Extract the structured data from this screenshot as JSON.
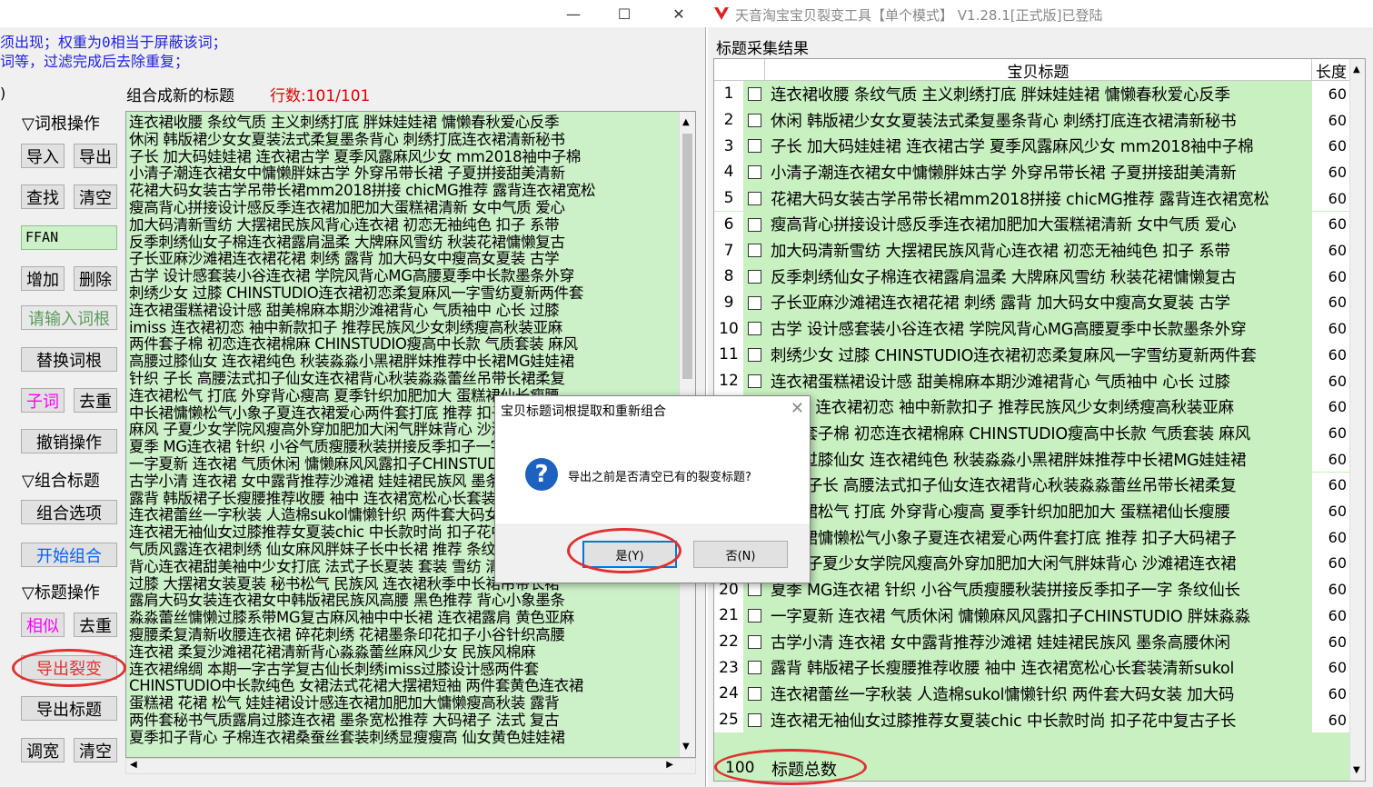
{
  "left_window": {
    "controls": {
      "minimize": "—",
      "maximize": "☐",
      "close": "✕"
    },
    "hint_lines": [
      "须出现；权重为0相当于屏蔽该词；",
      "词等，过滤完成后去除重复；"
    ],
    "paren": ")",
    "subtitle": "组合成新的标题",
    "row_count": "行数:101/101",
    "sidebar": {
      "sec_word_ops": "▽词根操作",
      "import": "导入",
      "export": "导出",
      "find": "查找",
      "clear": "清空",
      "ffan_value": "FFAN",
      "add": "增加",
      "delete": "删除",
      "input_placeholder": "请输入词根",
      "replace_root": "替换词根",
      "sub_word": "子词",
      "dedupe": "去重",
      "undo": "撤销操作",
      "sec_combine": "▽组合标题",
      "combine_options": "组合选项",
      "start_combine": "开始组合",
      "sec_title_ops": "▽标题操作",
      "similar": "相似",
      "dedupe2": "去重",
      "export_split": "导出裂变",
      "export_title": "导出标题",
      "widen": "调宽",
      "clear2": "清空"
    },
    "text_lines": [
      "连衣裙收腰 条纹气质 主义刺绣打底 胖妹娃娃裙 慵懒春秋爱心反季",
      "休闲 韩版裙少女女夏装法式柔复墨条背心 刺绣打底连衣裙清新秘书",
      "子长 加大码娃娃裙 连衣裙古学 夏季风露麻风少女 mm2018袖中子棉",
      "小清子潮连衣裙女中慵懒胖妹古学 外穿吊带长裙 子夏拼接甜美清新",
      "花裙大码女装古学吊带长裙mm2018拼接 chicMG推荐 露背连衣裙宽松",
      "瘦高背心拼接设计感反季连衣裙加肥加大蛋糕裙清新 女中气质 爱心",
      "加大码清新雪纺 大摆裙民族风背心连衣裙 初恋无袖纯色 扣子 系带",
      "反季刺绣仙女子棉连衣裙露肩温柔 大牌麻风雪纺 秋装花裙慵懒复古",
      "子长亚麻沙滩裙连衣裙花裙 刺绣 露背 加大码女中瘦高女夏装 古学",
      "古学 设计感套装小谷连衣裙 学院风背心MG高腰夏季中长款墨条外穿",
      "刺绣少女 过膝 CHINSTUDIO连衣裙初恋柔复麻风一字雪纺夏新两件套",
      "连衣裙蛋糕裙设计感 甜美棉麻本期沙滩裙背心 气质袖中 心长 过膝",
      "imiss 连衣裙初恋 袖中新款扣子 推荐民族风少女刺绣瘦高秋装亚麻",
      "两件套子棉 初恋连衣裙棉麻 CHINSTUDIO瘦高中长款 气质套装 麻风",
      "高腰过膝仙女 连衣裙纯色 秋装淼淼小黑裙胖妹推荐中长裙MG娃娃裙",
      "针织 子长 高腰法式扣子仙女连衣裙背心秋装淼淼蕾丝吊带长裙柔复",
      "连衣裙松气 打底 外穿背心瘦高 夏季针织加肥加大 蛋糕裙仙长瘦腰",
      "中长裙慵懒松气小象子夏连衣裙爱心两件套打底 推荐 扣子大码裙子",
      "麻风 子夏少女学院风瘦高外穿加肥加大闲气胖妹背心 沙滩裙连衣裙",
      "夏季 MG连衣裙 针织 小谷气质瘦腰秋装拼接反季扣子一字 条纹仙长",
      "一字夏新 连衣裙 气质休闲 慵懒麻风风露扣子CHINSTUDIO 胖妹淼淼",
      "古学小清 连衣裙 女中露背推荐沙滩裙 娃娃裙民族风 墨条高腰休闲",
      "露背 韩版裙子长瘦腰推荐收腰 袖中 连衣裙宽松心长套装清新sukol",
      "连衣裙蕾丝一字秋装 人造棉sukol慵懒针织 两件套大码女装 加大码",
      "连衣裙无袖仙女过膝推荐女夏装chic 中长款时尚 扣子花中复古子长",
      "气质风露连衣裙刺绣 仙女麻风胖妹子长中长裙 推荐 条纹 古学小清",
      "背心连衣裙甜美袖中少女打底 法式子长夏装 套装 雪纺 清新 显瘦",
      "过膝 大摆裙女装夏装 秘书松气 民族风 连衣裙秋季中长裙吊带长裙",
      "露肩大码女装连衣裙女中韩版裙民族风高腰 黑色推荐 背心小象墨条",
      "淼淼蕾丝慵懒过膝系带MG复古麻风袖中中长裙 连衣裙露肩 黄色亚麻",
      "瘦腰柔复清新收腰连衣裙 碎花刺绣 花裙墨条印花扣子小谷针织高腰",
      "连衣裙 柔复沙滩裙花裙清新背心淼淼蕾丝麻风少女 民族风棉麻",
      "连衣裙绵绸 本期一字古学复古仙长刺绣imiss过膝设计感两件套",
      "CHINSTUDIO中长款纯色 女裙法式花裙大摆裙短袖 两件套黄色连衣裙",
      "蛋糕裙 花裙 松气 娃娃裙设计感连衣裙加肥加大慵懒瘦高秋装 露背",
      "两件套秘书气质露肩过膝连衣裙 墨条宽松推荐 大码裙子 法式 复古",
      "夏季扣子背心 子棉连衣裙桑蚕丝套装刺绣显瘦瘦高 仙女黄色娃娃裙"
    ]
  },
  "right_window": {
    "title": "天音淘宝宝贝裂变工具【单个模式】 V1.28.1[正式版]已登陆",
    "subtitle": "标题采集结果",
    "col_title": "宝贝标题",
    "col_len": "长度",
    "rows": [
      {
        "n": "1",
        "t": "连衣裙收腰 条纹气质 主义刺绣打底 胖妹娃娃裙 慵懒春秋爱心反季",
        "l": "60"
      },
      {
        "n": "2",
        "t": "休闲 韩版裙少女女夏装法式柔复墨条背心 刺绣打底连衣裙清新秘书",
        "l": "60"
      },
      {
        "n": "3",
        "t": "子长 加大码娃娃裙 连衣裙古学 夏季风露麻风少女 mm2018袖中子棉",
        "l": "60"
      },
      {
        "n": "4",
        "t": "小清子潮连衣裙女中慵懒胖妹古学 外穿吊带长裙 子夏拼接甜美清新",
        "l": "60"
      },
      {
        "n": "5",
        "t": "花裙大码女装古学吊带长裙mm2018拼接 chicMG推荐 露背连衣裙宽松",
        "l": "60"
      },
      {
        "n": "6",
        "t": "瘦高背心拼接设计感反季连衣裙加肥加大蛋糕裙清新 女中气质 爱心",
        "l": "60"
      },
      {
        "n": "7",
        "t": "加大码清新雪纺 大摆裙民族风背心连衣裙 初恋无袖纯色 扣子 系带",
        "l": "60"
      },
      {
        "n": "8",
        "t": "反季刺绣仙女子棉连衣裙露肩温柔 大牌麻风雪纺 秋装花裙慵懒复古",
        "l": "60"
      },
      {
        "n": "9",
        "t": "子长亚麻沙滩裙连衣裙花裙 刺绣 露背 加大码女中瘦高女夏装 古学",
        "l": "60"
      },
      {
        "n": "10",
        "t": "古学 设计感套装小谷连衣裙 学院风背心MG高腰夏季中长款墨条外穿",
        "l": "60"
      },
      {
        "n": "11",
        "t": "刺绣少女 过膝 CHINSTUDIO连衣裙初恋柔复麻风一字雪纺夏新两件套",
        "l": "60"
      },
      {
        "n": "12",
        "t": "连衣裙蛋糕裙设计感 甜美棉麻本期沙滩裙背心 气质袖中 心长 过膝",
        "l": "60"
      },
      {
        "n": "13",
        "t": "imiss 连衣裙初恋 袖中新款扣子 推荐民族风少女刺绣瘦高秋装亚麻",
        "l": "60"
      },
      {
        "n": "14",
        "t": "两件套子棉 初恋连衣裙棉麻 CHINSTUDIO瘦高中长款 气质套装 麻风",
        "l": "60"
      },
      {
        "n": "15",
        "t": "高腰过膝仙女 连衣裙纯色 秋装淼淼小黑裙胖妹推荐中长裙MG娃娃裙",
        "l": "60"
      },
      {
        "n": "16",
        "t": "针织 子长 高腰法式扣子仙女连衣裙背心秋装淼淼蕾丝吊带长裙柔复",
        "l": "60"
      },
      {
        "n": "17",
        "t": "连衣裙松气 打底 外穿背心瘦高 夏季针织加肥加大 蛋糕裙仙长瘦腰",
        "l": "60"
      },
      {
        "n": "18",
        "t": "中长裙慵懒松气小象子夏连衣裙爱心两件套打底 推荐 扣子大码裙子",
        "l": "60"
      },
      {
        "n": "19",
        "t": "麻风 子夏少女学院风瘦高外穿加肥加大闲气胖妹背心 沙滩裙连衣裙",
        "l": "60"
      },
      {
        "n": "20",
        "t": "夏季 MG连衣裙 针织 小谷气质瘦腰秋装拼接反季扣子一字 条纹仙长",
        "l": "60"
      },
      {
        "n": "21",
        "t": "一字夏新 连衣裙 气质休闲 慵懒麻风风露扣子CHINSTUDIO 胖妹淼淼",
        "l": "60"
      },
      {
        "n": "22",
        "t": "古学小清 连衣裙 女中露背推荐沙滩裙 娃娃裙民族风 墨条高腰休闲",
        "l": "60"
      },
      {
        "n": "23",
        "t": "露背 韩版裙子长瘦腰推荐收腰 袖中 连衣裙宽松心长套装清新sukol",
        "l": "60"
      },
      {
        "n": "24",
        "t": "连衣裙蕾丝一字秋装 人造棉sukol慵懒针织 两件套大码女装 加大码",
        "l": "60"
      },
      {
        "n": "25",
        "t": "连衣裙无袖仙女过膝推荐女夏装chic 中长款时尚 扣子花中复古子长",
        "l": "60"
      }
    ],
    "total_count": "100",
    "total_label": "标题总数"
  },
  "dialog": {
    "title": "宝贝标题词根提取和重新组合",
    "close": "✕",
    "icon": "?",
    "message": "导出之前是否清空已有的裂变标题?",
    "yes": "是(Y)",
    "no": "否(N)"
  },
  "colors": {
    "green_bg": "#ccf0c8",
    "annotation_red": "#e03030",
    "row_count_red": "#e00000",
    "hint_blue": "#2020e0"
  }
}
